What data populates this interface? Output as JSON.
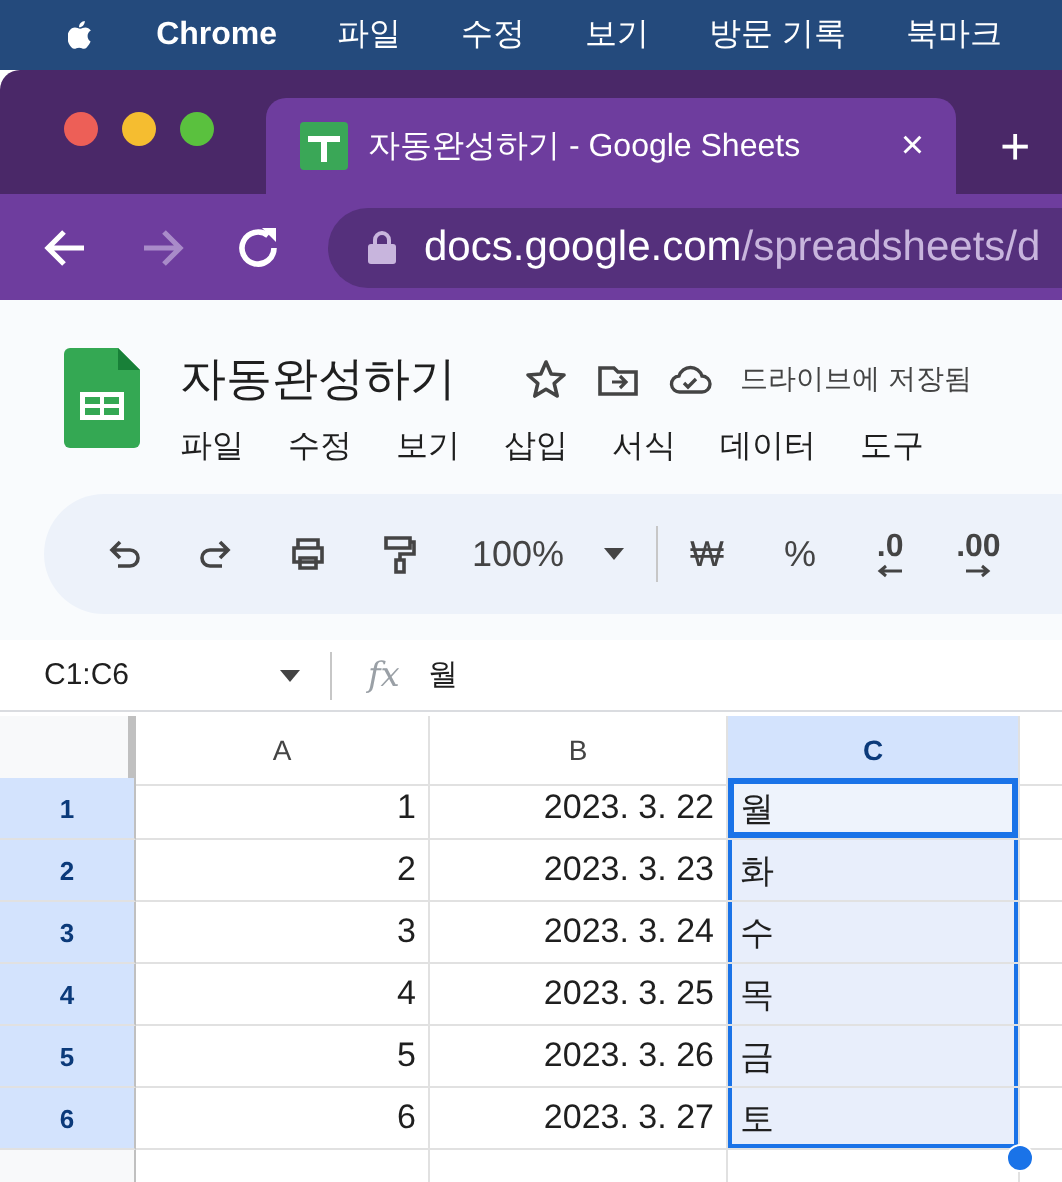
{
  "menubar": {
    "app": "Chrome",
    "items": [
      "파일",
      "수정",
      "보기",
      "방문 기록",
      "북마크"
    ]
  },
  "tab": {
    "title": "자동완성하기 - Google Sheets",
    "close": "×",
    "new_tab": "+"
  },
  "address_bar": {
    "host": "docs.google.com",
    "path": "/spreadsheets/d"
  },
  "doc": {
    "title": "자동완성하기",
    "save_status": "드라이브에 저장됨",
    "menu": [
      "파일",
      "수정",
      "보기",
      "삽입",
      "서식",
      "데이터",
      "도구"
    ]
  },
  "toolbar": {
    "zoom": "100%",
    "currency": "₩",
    "percent": "%",
    "decrease_decimal": ".0",
    "increase_decimal": ".00"
  },
  "formula_bar": {
    "name_box": "C1:C6",
    "fx": "fx",
    "value": "월"
  },
  "sheet": {
    "columns": [
      {
        "label": "A",
        "selected": false
      },
      {
        "label": "B",
        "selected": false
      },
      {
        "label": "C",
        "selected": true
      }
    ],
    "rows": [
      {
        "label": "1",
        "selected": true,
        "cells": [
          {
            "value": "1",
            "active": false
          },
          {
            "value": "2023. 3. 22",
            "active": false
          },
          {
            "value": "월",
            "active": true
          }
        ]
      },
      {
        "label": "2",
        "selected": true,
        "cells": [
          {
            "value": "2",
            "active": false
          },
          {
            "value": "2023. 3. 23",
            "active": false
          },
          {
            "value": "화",
            "active": false
          }
        ]
      },
      {
        "label": "3",
        "selected": true,
        "cells": [
          {
            "value": "3",
            "active": false
          },
          {
            "value": "2023. 3. 24",
            "active": false
          },
          {
            "value": "수",
            "active": false
          }
        ]
      },
      {
        "label": "4",
        "selected": true,
        "cells": [
          {
            "value": "4",
            "active": false
          },
          {
            "value": "2023. 3. 25",
            "active": false
          },
          {
            "value": "목",
            "active": false
          }
        ]
      },
      {
        "label": "5",
        "selected": true,
        "cells": [
          {
            "value": "5",
            "active": false
          },
          {
            "value": "2023. 3. 26",
            "active": false
          },
          {
            "value": "금",
            "active": false
          }
        ]
      },
      {
        "label": "6",
        "selected": true,
        "cells": [
          {
            "value": "6",
            "active": false
          },
          {
            "value": "2023. 3. 27",
            "active": false
          },
          {
            "value": "토",
            "active": false
          }
        ]
      }
    ]
  }
}
